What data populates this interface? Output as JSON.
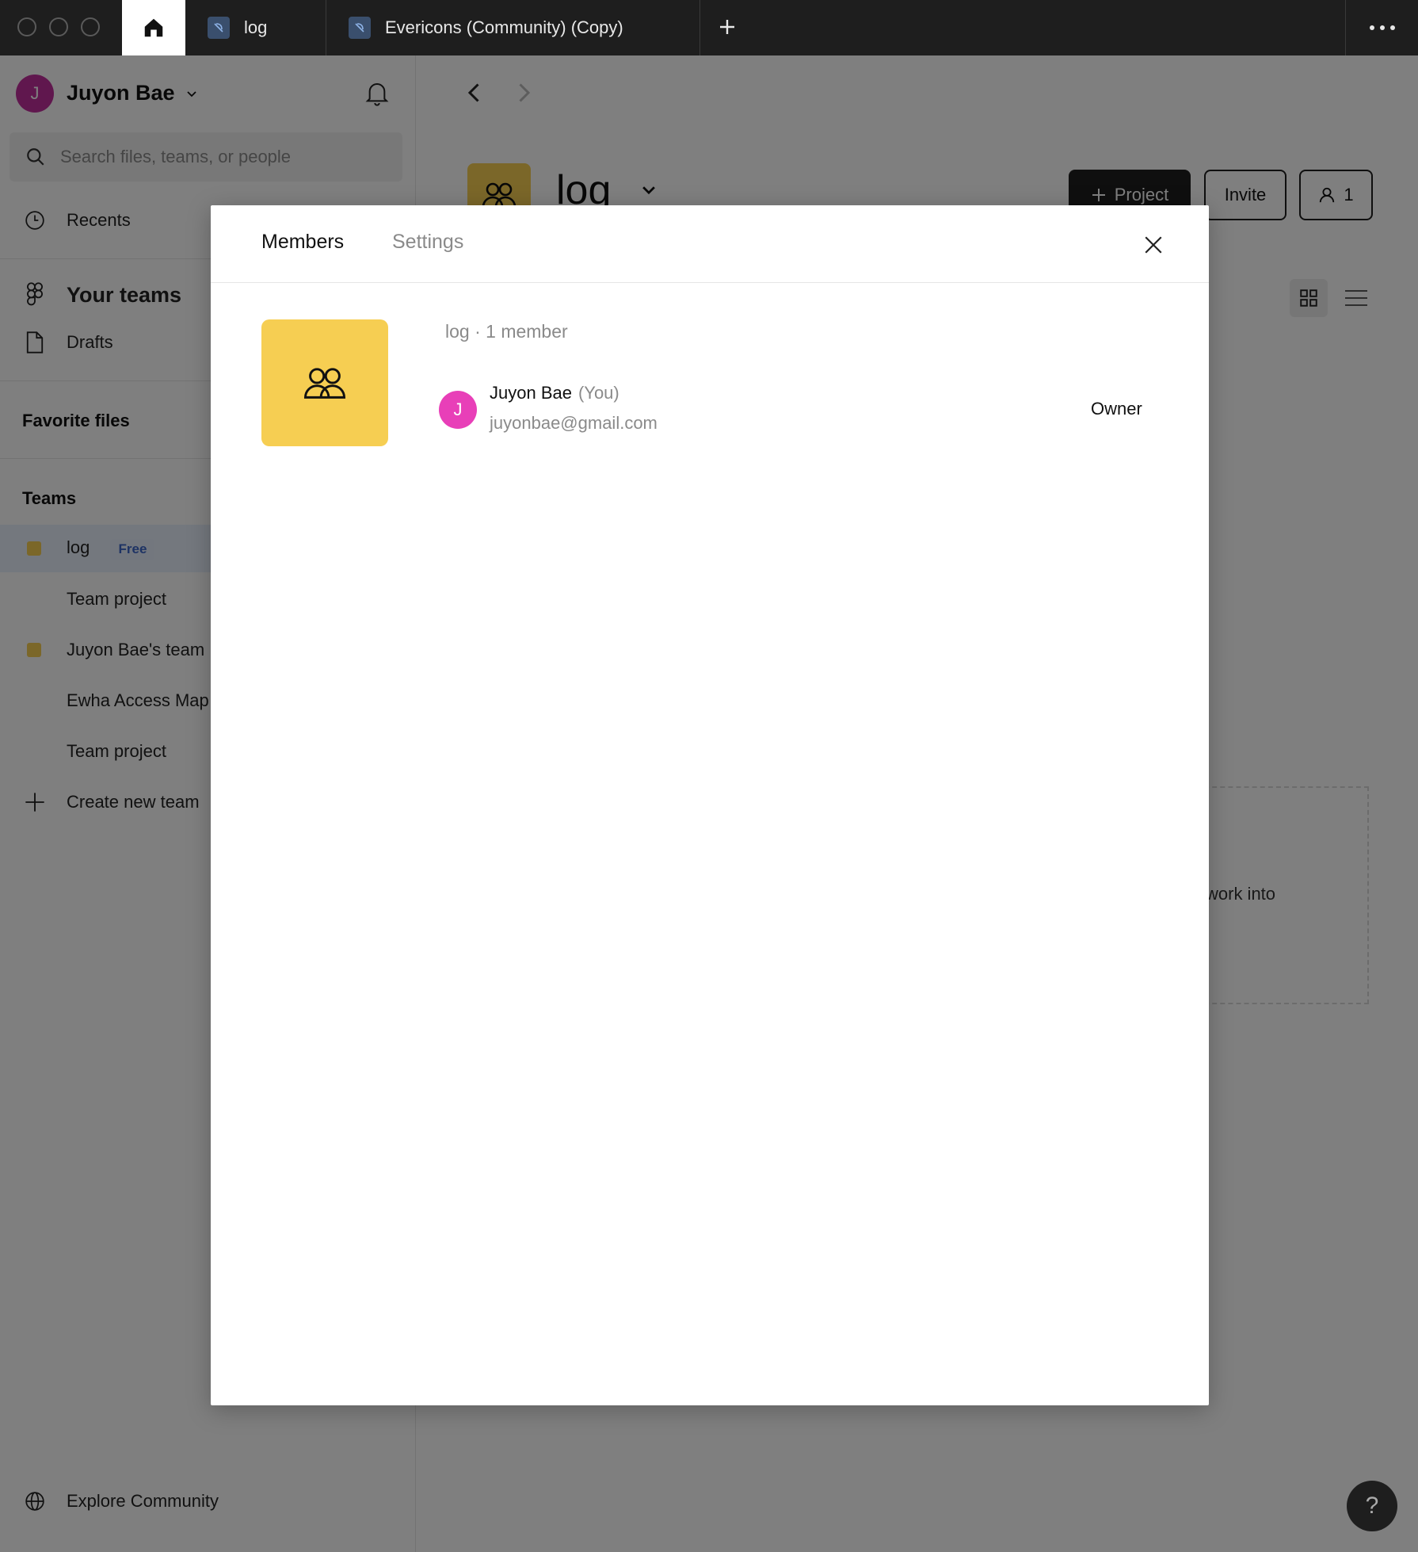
{
  "tabs": {
    "home_label": "",
    "file_tab_1": "log",
    "file_tab_2": "Evericons (Community) (Copy)"
  },
  "sidebar": {
    "user_name": "Juyon Bae",
    "user_initial": "J",
    "search_placeholder": "Search files, teams, or people",
    "recents": "Recents",
    "your_teams": "Your teams",
    "drafts": "Drafts",
    "favorite_files": "Favorite files",
    "teams_heading": "Teams",
    "teams": [
      {
        "name": "log",
        "badge": "Free"
      },
      {
        "name": "Team project"
      },
      {
        "name": "Juyon Bae's team"
      },
      {
        "name": "Ewha Access Map"
      },
      {
        "name": "Team project"
      }
    ],
    "create_team": "Create new team",
    "explore_community": "Explore Community"
  },
  "main": {
    "team_title": "log",
    "project_button": "Project",
    "invite_button": "Invite",
    "members_count_button": "1",
    "empty_card_text": "work into"
  },
  "modal": {
    "tab_members": "Members",
    "tab_settings": "Settings",
    "member_summary": "log · 1 member",
    "member": {
      "initial": "J",
      "name": "Juyon Bae",
      "you_tag": "(You)",
      "email": "juyonbae@gmail.com",
      "role": "Owner"
    }
  },
  "help": "?",
  "colors": {
    "team_yellow": "#f6ce52",
    "avatar_pink": "#e83fb8",
    "sidebar_avatar": "#c02e9c",
    "dark": "#1e1e1e",
    "badge_blue": "#3d67c8"
  }
}
